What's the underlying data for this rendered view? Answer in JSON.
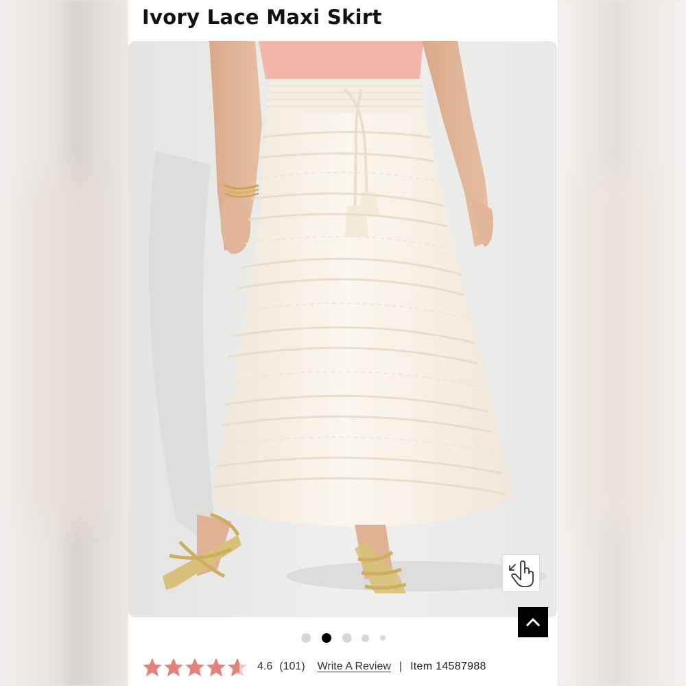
{
  "product": {
    "title": "Ivory Lace Maxi Skirt",
    "image_alt": "Model wearing ivory lace tiered maxi skirt with tassel drawstring and gold strappy sandals"
  },
  "gallery": {
    "total_images": 5,
    "active_index": 1
  },
  "rating": {
    "value": "4.6",
    "stars_fraction": 0.92,
    "count": "(101)",
    "write_review_label": "Write A Review",
    "separator": "|",
    "item_label": "Item 14587988"
  },
  "colors": {
    "star": "#e0837a",
    "star_empty": "#f0c9c4",
    "skirt": "#f7f0e4",
    "top": "#f2b7aa",
    "back_to_top_bg": "#000000"
  },
  "icons": {
    "zoom": "tap-to-zoom-icon",
    "back_to_top": "chevron-up-icon"
  }
}
